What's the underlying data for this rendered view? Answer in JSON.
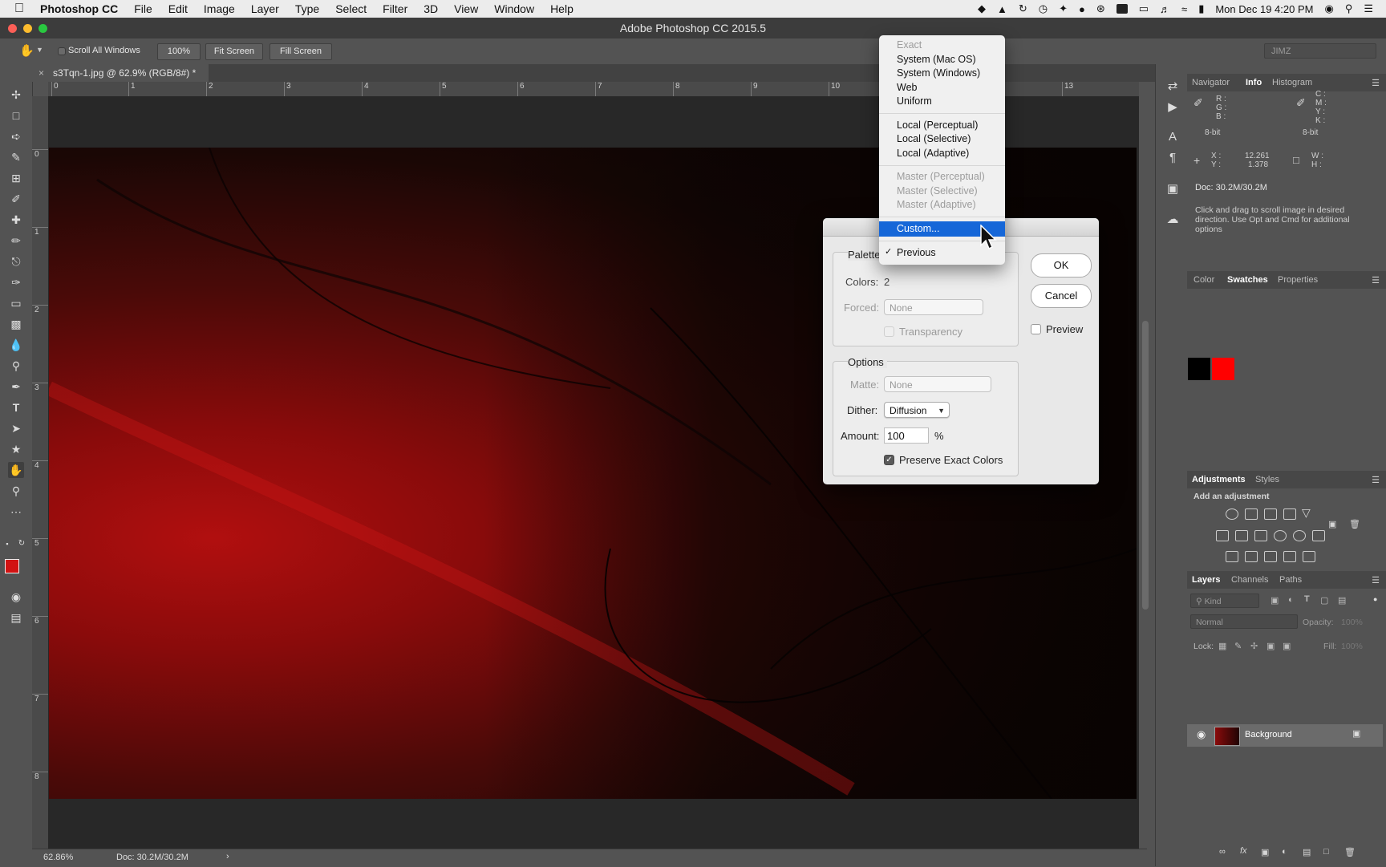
{
  "menubar": {
    "app": "Photoshop CC",
    "items": [
      "File",
      "Edit",
      "Image",
      "Layer",
      "Type",
      "Select",
      "Filter",
      "3D",
      "View",
      "Window",
      "Help"
    ],
    "datetime": "Mon Dec 19  4:20 PM"
  },
  "window": {
    "title": "Adobe Photoshop CC 2015.5"
  },
  "options": {
    "scroll_all": "Scroll All Windows",
    "zoom_100": "100%",
    "fit_screen": "Fit Screen",
    "fill_screen": "Fill Screen",
    "workspace": "JIMZ"
  },
  "document": {
    "tab_title": "s3Tqn-1.jpg @ 62.9% (RGB/8#) *",
    "ruler_h": [
      "0",
      "1",
      "2",
      "3",
      "4",
      "5",
      "6",
      "7",
      "8",
      "9",
      "10",
      "13"
    ],
    "ruler_v": [
      "0",
      "1",
      "2",
      "3",
      "4",
      "5",
      "6",
      "7",
      "8"
    ]
  },
  "status": {
    "zoom": "62.86%",
    "doc": "Doc: 30.2M/30.2M"
  },
  "info_panel": {
    "tabs": [
      "Navigator",
      "Info",
      "Histogram"
    ],
    "rgb_labels": [
      "R :",
      "G :",
      "B :"
    ],
    "cmyk_labels": [
      "C :",
      "M :",
      "Y :",
      "K :"
    ],
    "bit_left": "8-bit",
    "bit_right": "8-bit",
    "x_label": "X :",
    "y_label": "Y :",
    "x_value": "12.261",
    "y_value": "1.378",
    "w_label": "W :",
    "h_label": "H :",
    "doc": "Doc: 30.2M/30.2M",
    "hint": "Click and drag to scroll image in desired direction.  Use Opt and Cmd for additional options"
  },
  "swatches_panel": {
    "tabs": [
      "Color",
      "Swatches",
      "Properties"
    ],
    "colors": [
      "#000000",
      "#ff0000"
    ]
  },
  "adjustments_panel": {
    "tabs": [
      "Adjustments",
      "Styles"
    ],
    "heading": "Add an adjustment"
  },
  "layers_panel": {
    "tabs": [
      "Layers",
      "Channels",
      "Paths"
    ],
    "kind": "Kind",
    "blend": "Normal",
    "opacity_label": "Opacity:",
    "opacity_value": "100%",
    "lock_label": "Lock:",
    "fill_label": "Fill:",
    "fill_value": "100%",
    "layer_name": "Background"
  },
  "dialog": {
    "palette_label": "Palette",
    "colors_label": "Colors:",
    "colors_value": "2",
    "forced_label": "Forced:",
    "forced_value": "None",
    "transparency_label": "Transparency",
    "options_label": "Options",
    "matte_label": "Matte:",
    "matte_value": "None",
    "dither_label": "Dither:",
    "dither_value": "Diffusion",
    "amount_label": "Amount:",
    "amount_value": "100",
    "amount_unit": "%",
    "preserve_label": "Preserve Exact Colors",
    "ok": "OK",
    "cancel": "Cancel",
    "preview": "Preview"
  },
  "palette_menu": {
    "items": [
      "Exact",
      "System (Mac OS)",
      "System (Windows)",
      "Web",
      "Uniform",
      "Local (Perceptual)",
      "Local (Selective)",
      "Local (Adaptive)",
      "Master (Perceptual)",
      "Master (Selective)",
      "Master (Adaptive)",
      "Custom...",
      "Previous"
    ],
    "selected": "Custom...",
    "checked": "Previous"
  },
  "colors": {
    "accent": "#1667d8",
    "fg_swatch": "#d11212",
    "canvas_red": "#b10f0f"
  }
}
